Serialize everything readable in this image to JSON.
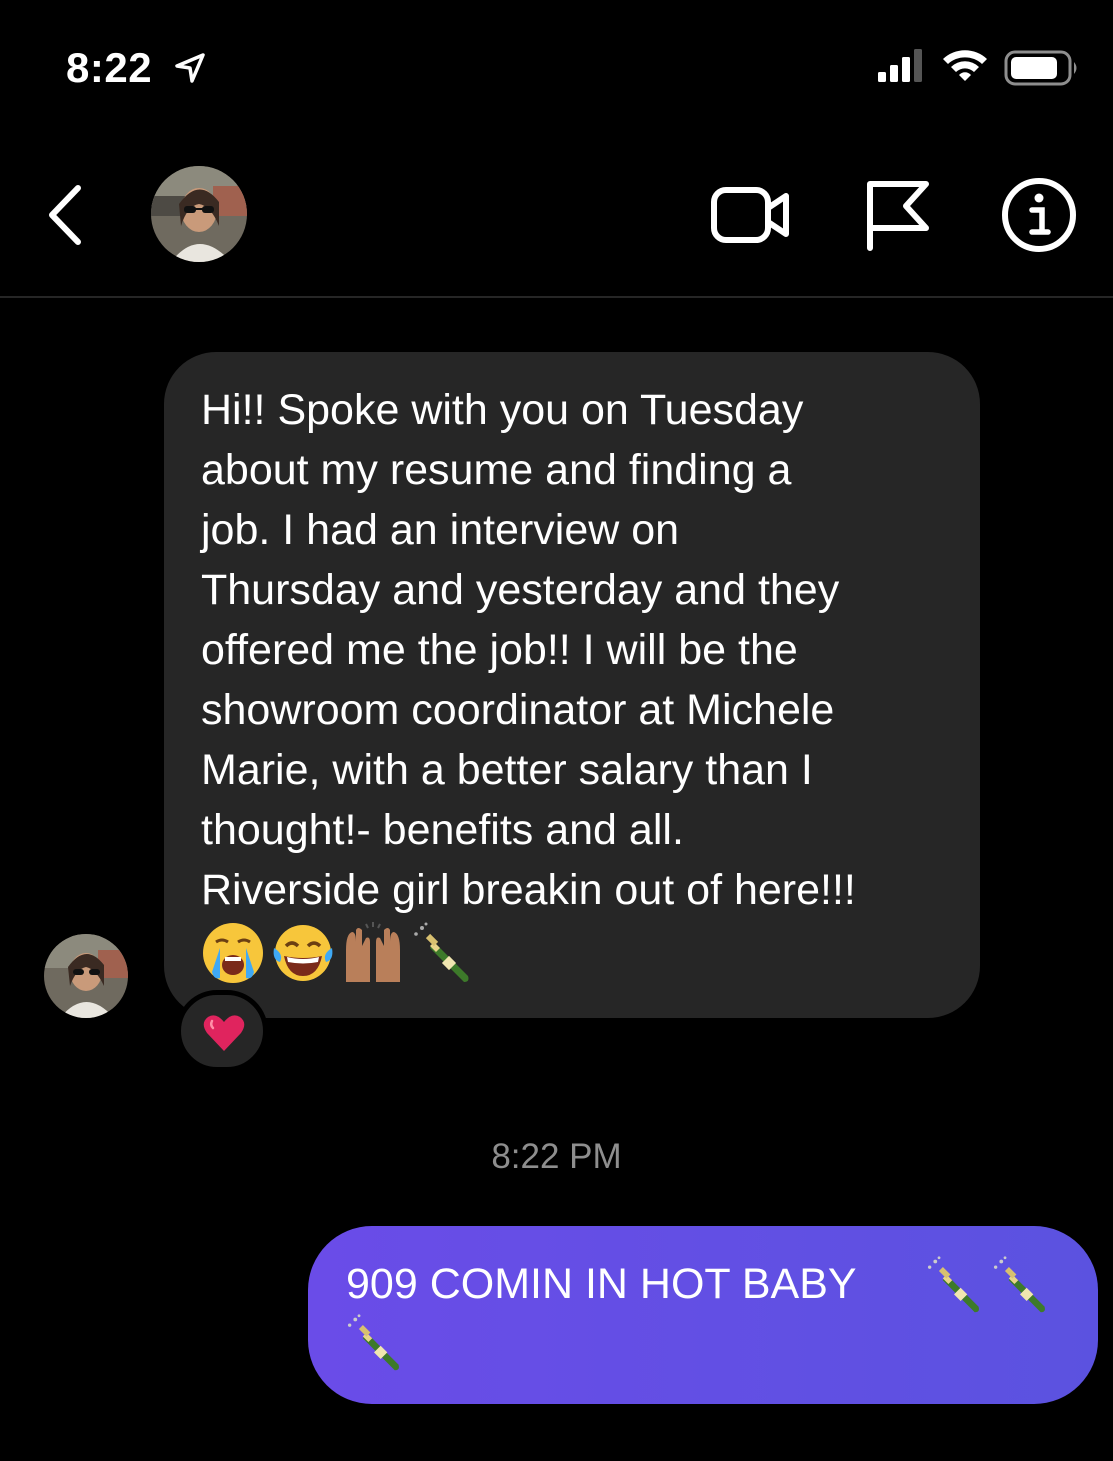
{
  "status_bar": {
    "time": "8:22",
    "icons": [
      "location-arrow-icon",
      "cellular-signal-icon",
      "wifi-icon",
      "battery-icon"
    ]
  },
  "header": {
    "back_icon": "chevron-left-icon",
    "actions": [
      "video-call-icon",
      "flag-icon",
      "info-icon"
    ]
  },
  "messages": [
    {
      "direction": "received",
      "text": "Hi!! Spoke with you on Tuesday\nabout my resume and finding a\njob. I had an interview on\nThursday and yesterday and they\noffered me the job!! I will be the\nshowroom coordinator at Michele\nMarie, with a better salary than I\nthought!- benefits and all.\nRiverside girl breakin out of here!!!",
      "emojis": [
        "crying-face-icon",
        "tears-of-joy-icon",
        "raising-hands-icon",
        "champagne-bottle-icon"
      ],
      "reaction": "red-heart-icon"
    },
    {
      "direction": "sent",
      "text": "909 COMIN IN HOT BABY",
      "emojis": [
        "champagne-bottle-icon",
        "champagne-bottle-icon",
        "champagne-bottle-icon"
      ]
    }
  ],
  "timestamp": "8:22 PM",
  "colors": {
    "background": "#000000",
    "received_bubble": "#262626",
    "sent_bubble": "#5f50e4",
    "timestamp": "#8e8e8e",
    "heart": "#e0245e"
  }
}
